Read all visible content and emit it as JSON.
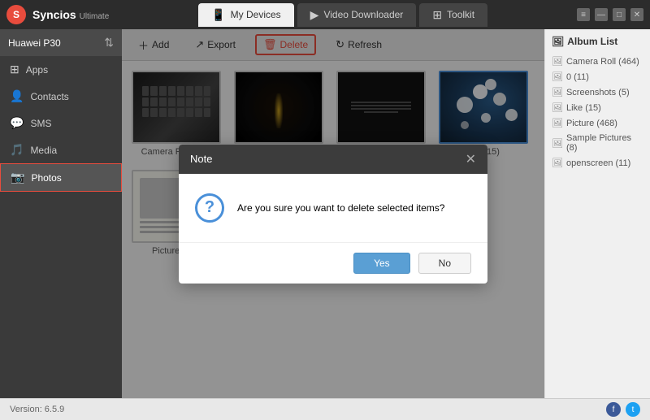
{
  "app": {
    "name": "Syncios",
    "edition": "Ultimate",
    "version": "Version: 6.5.9"
  },
  "titlebar": {
    "tabs": [
      {
        "id": "my-devices",
        "label": "My Devices",
        "icon": "📱",
        "active": true
      },
      {
        "id": "video-downloader",
        "label": "Video Downloader",
        "icon": "▶",
        "active": false
      },
      {
        "id": "toolkit",
        "label": "Toolkit",
        "icon": "⊞",
        "active": false
      }
    ],
    "controls": [
      "□",
      "—",
      "□",
      "✕"
    ]
  },
  "sidebar": {
    "device": "Huawei P30",
    "items": [
      {
        "id": "apps",
        "label": "Apps",
        "icon": "⊞"
      },
      {
        "id": "contacts",
        "label": "Contacts",
        "icon": "👤"
      },
      {
        "id": "sms",
        "label": "SMS",
        "icon": "💬"
      },
      {
        "id": "media",
        "label": "Media",
        "icon": "🎵"
      },
      {
        "id": "photos",
        "label": "Photos",
        "icon": "📷",
        "active": true
      }
    ]
  },
  "toolbar": {
    "add_label": "Add",
    "export_label": "Export",
    "delete_label": "Delete",
    "refresh_label": "Refresh"
  },
  "photos": {
    "grid": [
      {
        "id": "camera-roll",
        "label": "Camera Roll(464)",
        "selected": false,
        "type": "keyboard"
      },
      {
        "id": "zero",
        "label": "0(11)",
        "selected": false,
        "type": "corridor"
      },
      {
        "id": "screenshots",
        "label": "Screenshots(5)",
        "selected": false,
        "type": "text"
      },
      {
        "id": "like",
        "label": "Like(15)",
        "selected": true,
        "type": "flowers"
      },
      {
        "id": "picture",
        "label": "Picture(468)",
        "selected": false,
        "type": "picture"
      },
      {
        "id": "sample-pictures",
        "label": "Sample Pictures(8)",
        "selected": false,
        "type": "dark"
      },
      {
        "id": "openscreen",
        "label": "openscreen(11)",
        "selected": false,
        "type": "gray"
      }
    ]
  },
  "album_list": {
    "title": "Album List",
    "items": [
      {
        "label": "Camera Roll (464)"
      },
      {
        "label": "0 (11)"
      },
      {
        "label": "Screenshots (5)"
      },
      {
        "label": "Like (15)"
      },
      {
        "label": "Picture (468)"
      },
      {
        "label": "Sample Pictures (8)"
      },
      {
        "label": "openscreen (11)"
      }
    ]
  },
  "modal": {
    "title": "Note",
    "message": "Are you sure you want to delete selected items?",
    "yes_label": "Yes",
    "no_label": "No"
  },
  "statusbar": {
    "version": "Version: 6.5.9"
  }
}
